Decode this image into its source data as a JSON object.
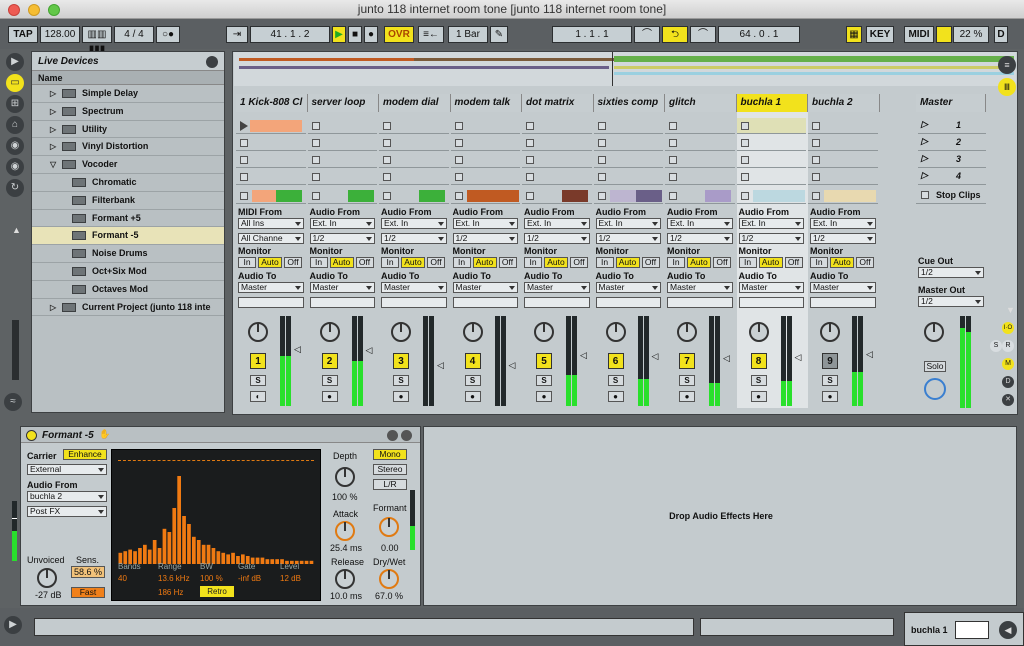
{
  "window": {
    "title": "junto 118 internet room tone  [junto 118 internet room tone]"
  },
  "control_bar": {
    "tap": "TAP",
    "tempo": "128.00",
    "signature": "4 / 4",
    "metro": "○●",
    "position": "41 .  1 .  2",
    "ovr": "OVR",
    "quantize": "1 Bar",
    "loop_start": "1 .  1 .  1",
    "loop_length": "64 .  0 .  1",
    "key": "KEY",
    "midi": "MIDI",
    "cpu": "22 %",
    "d": "D"
  },
  "sidebar": {
    "icons": [
      "play-icon",
      "live-devices-icon",
      "plugin-icon",
      "places-icon",
      "disk-icon",
      "disk2-icon",
      "refresh-icon",
      "scroll-up-icon",
      "wave-icon"
    ]
  },
  "browser": {
    "title": "Live Devices",
    "column": "Name",
    "items": [
      {
        "label": "Simple Delay",
        "indent": 1,
        "expand": "▷"
      },
      {
        "label": "Spectrum",
        "indent": 1,
        "expand": "▷"
      },
      {
        "label": "Utility",
        "indent": 1,
        "expand": "▷"
      },
      {
        "label": "Vinyl Distortion",
        "indent": 1,
        "expand": "▷"
      },
      {
        "label": "Vocoder",
        "indent": 1,
        "expand": "▽"
      },
      {
        "label": "Chromatic",
        "indent": 2,
        "expand": ""
      },
      {
        "label": "Filterbank",
        "indent": 2,
        "expand": ""
      },
      {
        "label": "Formant +5",
        "indent": 2,
        "expand": ""
      },
      {
        "label": "Formant -5",
        "indent": 2,
        "expand": "",
        "selected": true
      },
      {
        "label": "Noise Drums",
        "indent": 2,
        "expand": ""
      },
      {
        "label": "Oct+Six Mod",
        "indent": 2,
        "expand": ""
      },
      {
        "label": "Octaves Mod",
        "indent": 2,
        "expand": ""
      },
      {
        "label": "Current Project (junto 118 inte",
        "indent": 1,
        "expand": "▷"
      }
    ]
  },
  "session": {
    "tracks": [
      {
        "name": "1 Kick-808 Cl",
        "num": "1",
        "from_label": "MIDI From",
        "from": "All Ins",
        "chan": "All Channe",
        "clip": "#f3a57a",
        "clipbar": "#3cb03a",
        "meter": 0.55,
        "selected": false
      },
      {
        "name": "server loop",
        "num": "2",
        "from_label": "Audio From",
        "from": "Ext. In",
        "chan": "1/2",
        "clip": "",
        "clipbar": "#3cb03a",
        "meter": 0.5,
        "selected": false
      },
      {
        "name": "modem dial",
        "num": "3",
        "from_label": "Audio From",
        "from": "Ext. In",
        "chan": "1/2",
        "clip": "",
        "clipbar": "#3cb03a",
        "meter": 0.0,
        "selected": false
      },
      {
        "name": "modem talk",
        "num": "4",
        "from_label": "Audio From",
        "from": "Ext. In",
        "chan": "1/2",
        "clip": "#c05a22",
        "clipbar": "",
        "meter": 0.0,
        "selected": false
      },
      {
        "name": "dot matrix",
        "num": "5",
        "from_label": "Audio From",
        "from": "Ext. In",
        "chan": "1/2",
        "clip": "",
        "clipbar": "#7a3a2a",
        "meter": 0.35,
        "selected": false
      },
      {
        "name": "sixties comp",
        "num": "6",
        "from_label": "Audio From",
        "from": "Ext. In",
        "chan": "1/2",
        "clip": "#bdb5d0",
        "clipbar": "#6a5f88",
        "meter": 0.3,
        "selected": false
      },
      {
        "name": "glitch",
        "num": "7",
        "from_label": "Audio From",
        "from": "Ext. In",
        "chan": "1/2",
        "clip": "",
        "clipbar": "#a99bc8",
        "meter": 0.25,
        "selected": false
      },
      {
        "name": "buchla 1",
        "num": "8",
        "from_label": "Audio From",
        "from": "Ext. In",
        "chan": "1/2",
        "clip": "#bcd8e0",
        "clipbar": "",
        "meter": 0.28,
        "selected": true
      },
      {
        "name": "buchla 2",
        "num": "9",
        "from_label": "Audio From",
        "from": "Ext. In",
        "chan": "1/2",
        "clip": "#e8d9b0",
        "clipbar": "",
        "meter": 0.38,
        "selected": false
      }
    ],
    "monitor_label": "Monitor",
    "audio_to_label": "Audio To",
    "route": "Master",
    "mon": [
      "In",
      "Auto",
      "Off"
    ],
    "solo": "S",
    "master": {
      "name": "Master",
      "scenes": [
        "1",
        "2",
        "3",
        "4"
      ],
      "stop_clips": "Stop Clips",
      "cue_out_label": "Cue Out",
      "cue_out": "1/2",
      "master_out_label": "Master Out",
      "master_out": "1/2",
      "solo": "Solo"
    }
  },
  "device": {
    "name": "Formant -5",
    "carrier_label": "Carrier",
    "enhance": "Enhance",
    "carrier": "External",
    "audio_from_label": "Audio From",
    "audio_from": "buchla 2",
    "post": "Post FX",
    "unvoiced_label": "Unvoiced",
    "unvoiced": "-27 dB",
    "sens_label": "Sens.",
    "sens": "58.6 %",
    "fast": "Fast",
    "bands_label": "Bands",
    "bands": "40",
    "range_label": "Range",
    "range_hi": "13.6 kHz",
    "range_lo": "186 Hz",
    "bw_label": "BW",
    "bw": "100 %",
    "gate_label": "Gate",
    "gate": "-inf dB",
    "level_label": "Level",
    "level": "12 dB",
    "retro": "Retro",
    "spectrum": [
      0.07,
      0.08,
      0.09,
      0.08,
      0.1,
      0.12,
      0.09,
      0.15,
      0.1,
      0.22,
      0.2,
      0.35,
      0.55,
      0.3,
      0.25,
      0.17,
      0.15,
      0.12,
      0.12,
      0.1,
      0.08,
      0.07,
      0.06,
      0.07,
      0.05,
      0.06,
      0.05,
      0.04,
      0.04,
      0.04,
      0.03,
      0.03,
      0.03,
      0.03,
      0.02,
      0.02,
      0.02,
      0.02,
      0.02,
      0.02
    ],
    "depth_label": "Depth",
    "depth": "100 %",
    "attack_label": "Attack",
    "attack": "25.4 ms",
    "release_label": "Release",
    "release": "10.0 ms",
    "mono": "Mono",
    "stereo": "Stereo",
    "lr": "L/R",
    "formant_label": "Formant",
    "formant": "0.00",
    "drywet_label": "Dry/Wet",
    "drywet": "67.0 %"
  },
  "drop_area": "Drop Audio Effects Here",
  "status": {
    "selected_track": "buchla 1"
  },
  "right_side": {
    "io": "I·O",
    "s": "S",
    "r": "R",
    "m": "M",
    "d": "D"
  }
}
